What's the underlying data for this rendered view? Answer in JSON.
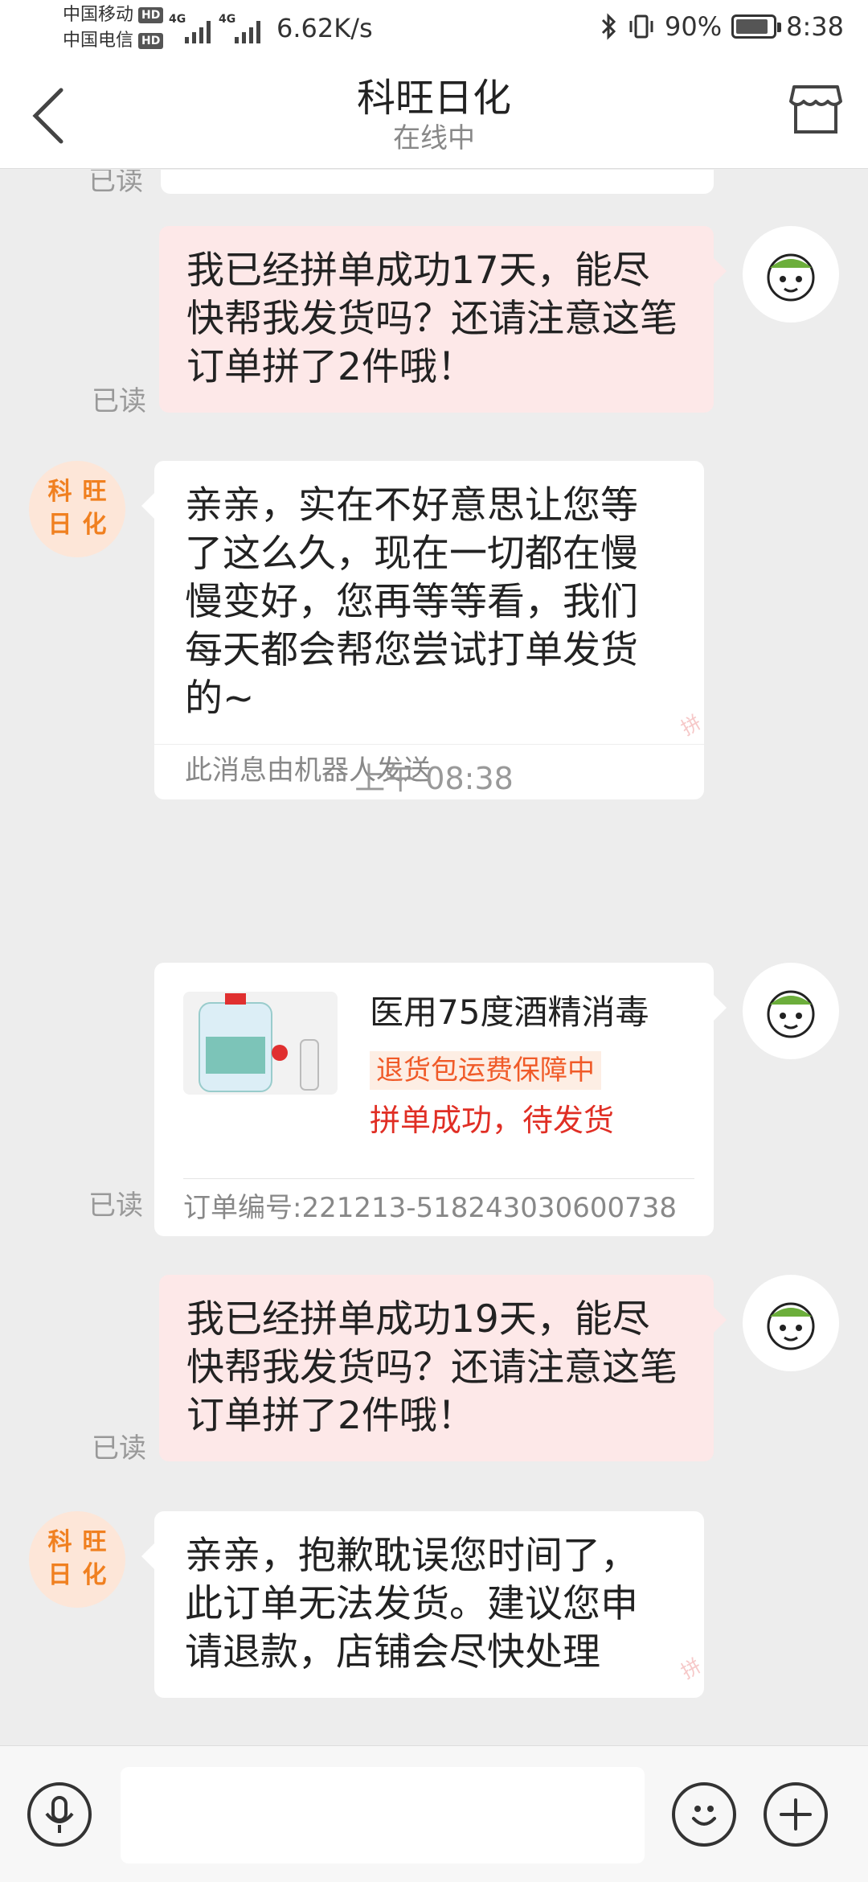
{
  "status_bar": {
    "carrier1": "中国移动",
    "carrier2": "中国电信",
    "hd": "HD",
    "net_type": "4G",
    "net_speed": "6.62K/s",
    "battery": "90%",
    "time": "8:38"
  },
  "header": {
    "title": "科旺日化",
    "subtitle": "在线中",
    "back_icon": "chevron-left-icon",
    "store_icon": "store-icon"
  },
  "chat": {
    "read_label": "已读",
    "robot_note": "此消息由机器人发送",
    "shop_avatar_chars": [
      "科",
      "旺",
      "日",
      "化"
    ],
    "watermark": "拼",
    "messages": [
      {
        "from": "user",
        "text": "我已经拼单成功17天，能尽快帮我发货吗？还请注意这笔订单拼了2件哦！"
      },
      {
        "from": "shop",
        "text": "亲亲，实在不好意思让您等了这么久，现在一切都在慢慢变好，您再等等看，我们每天都会帮您尝试打单发货的~"
      },
      {
        "type": "timestamp",
        "text": "上午 08:38"
      },
      {
        "from": "user",
        "type": "product",
        "name": "医用75度酒精消毒",
        "tag": "退货包运费保障中",
        "status": "拼单成功，待发货",
        "order": "订单编号:221213-518243030600738"
      },
      {
        "from": "user",
        "text": "我已经拼单成功19天，能尽快帮我发货吗？还请注意这笔订单拼了2件哦！"
      },
      {
        "from": "shop",
        "text": "亲亲，抱歉耽误您时间了，此订单无法发货。建议您申请退款，店铺会尽快处理"
      }
    ]
  },
  "input_bar": {
    "placeholder": "",
    "mic_icon": "microphone-icon",
    "emoji_icon": "emoji-icon",
    "plus_icon": "plus-icon"
  },
  "colors": {
    "user_bubble": "#fde8e8",
    "shop_bubble": "#ffffff",
    "accent_orange": "#f08020",
    "status_red": "#e02e24",
    "background": "#ededed"
  }
}
